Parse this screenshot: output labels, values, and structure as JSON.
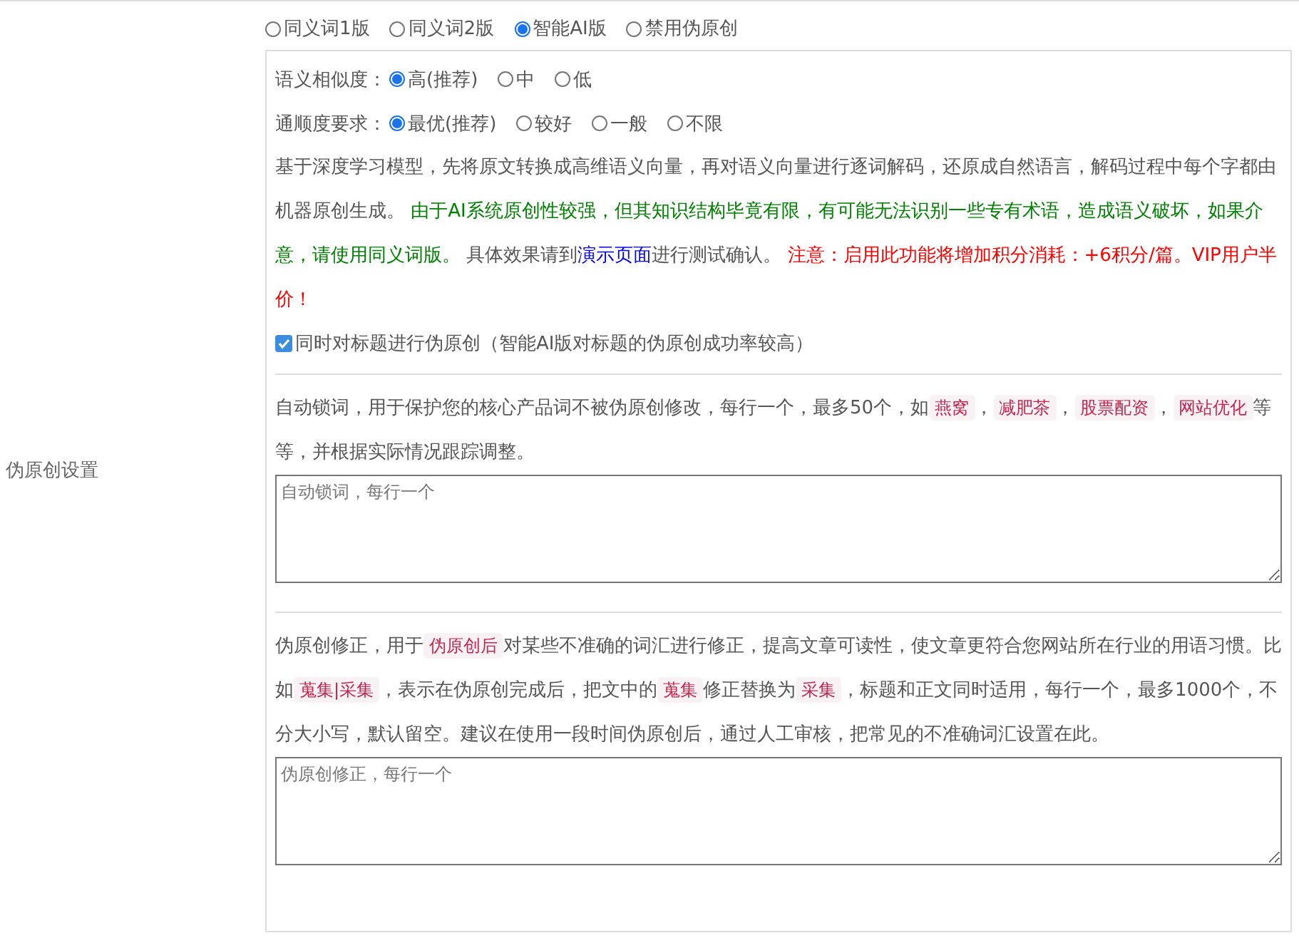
{
  "section_label": "伪原创设置",
  "modes": [
    {
      "label": "同义词1版",
      "selected": false
    },
    {
      "label": "同义词2版",
      "selected": false
    },
    {
      "label": "智能AI版",
      "selected": true
    },
    {
      "label": "禁用伪原创",
      "selected": false
    }
  ],
  "option_groups": [
    {
      "label": "语义相似度：",
      "options": [
        {
          "label": "高(推荐)",
          "selected": true
        },
        {
          "label": "中",
          "selected": false
        },
        {
          "label": "低",
          "selected": false
        }
      ]
    },
    {
      "label": "通顺度要求：",
      "options": [
        {
          "label": "最优(推荐)",
          "selected": true
        },
        {
          "label": "较好",
          "selected": false
        },
        {
          "label": "一般",
          "selected": false
        },
        {
          "label": "不限",
          "selected": false
        }
      ]
    }
  ],
  "description": [
    {
      "kind": "text",
      "text": "基于深度学习模型，先将原文转换成高维语义向量，再对语义向量进行逐词解码，还原成自然语言，解码过程中每个字都由机器原创生成。 "
    },
    {
      "kind": "notice",
      "text": "由于AI系统原创性较强，但其知识结构毕竟有限，有可能无法识别一些专有术语，造成语义破坏，如果介意，请使用同义词版。"
    },
    {
      "kind": "text",
      "text": " 具体效果请到"
    },
    {
      "kind": "link",
      "text": "演示页面"
    },
    {
      "kind": "text",
      "text": "进行测试确认。 "
    },
    {
      "kind": "warning",
      "text": "注意：启用此功能将增加积分消耗：+6积分/篇。VIP用户半价！"
    }
  ],
  "title_option": {
    "label": "同时对标题进行伪原创（智能AI版对标题的伪原创成功率较高）",
    "checked": true
  },
  "lock_words": {
    "description": [
      {
        "kind": "text",
        "text": "自动锁词，用于保护您的核心产品词不被伪原创修改，每行一个，最多50个，如"
      },
      {
        "kind": "code",
        "text": "燕窝"
      },
      {
        "kind": "text",
        "text": "，"
      },
      {
        "kind": "code",
        "text": "减肥茶"
      },
      {
        "kind": "text",
        "text": "，"
      },
      {
        "kind": "code",
        "text": "股票配资"
      },
      {
        "kind": "text",
        "text": "，"
      },
      {
        "kind": "code",
        "text": "网站优化"
      },
      {
        "kind": "text",
        "text": "等等，并根据实际情况跟踪调整。"
      }
    ],
    "placeholder": "自动锁词，每行一个"
  },
  "correction": {
    "description": [
      {
        "kind": "text",
        "text": "伪原创修正，用于"
      },
      {
        "kind": "code",
        "text": "伪原创后"
      },
      {
        "kind": "text",
        "text": "对某些不准确的词汇进行修正，提高文章可读性，使文章更符合您网站所在行业的用语习惯。比如"
      },
      {
        "kind": "code",
        "text": "蒐集|采集"
      },
      {
        "kind": "text",
        "text": "，表示在伪原创完成后，把文中的"
      },
      {
        "kind": "code",
        "text": "蒐集"
      },
      {
        "kind": "text",
        "text": "修正替换为"
      },
      {
        "kind": "code",
        "text": "采集"
      },
      {
        "kind": "text",
        "text": "，标题和正文同时适用，每行一个，最多1000个，不分大小写，默认留空。建议在使用一段时间伪原创后，通过人工审核，把常见的不准确词汇设置在此。"
      }
    ],
    "placeholder": "伪原创修正，每行一个"
  }
}
